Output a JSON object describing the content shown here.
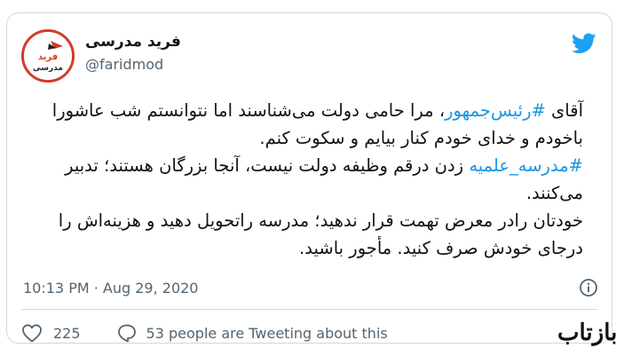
{
  "author": {
    "display_name": "فرید مدرسی",
    "handle": "@faridmod",
    "avatar_text": "فرید مدرسی"
  },
  "tweet": {
    "para1": {
      "before": "آقای ",
      "hashtag": "#رئیس‌جمهور",
      "after": "، مرا حامی دولت می‌شناسند اما نتوانستم شب عاشورا باخودم و خدای خودم کنار بیایم و سکوت کنم."
    },
    "para2": {
      "hashtag": "#مدرسه_علمیه",
      "after": " زدن درقم وظیفه دولت نیست، آنجا بزرگان هستند؛ تدبیر می‌کنند."
    },
    "para3": "خودتان رادر معرض تهمت قرار ندهید؛ مدرسه راتحویل دهید و هزینه‌اش را درجای خودش صرف کنید. مأجور باشید."
  },
  "meta": {
    "timestamp": "10:13 PM · Aug 29, 2020"
  },
  "actions": {
    "like_count": "225",
    "tweeting_text": "53 people are Tweeting about this"
  },
  "watermark": {
    "text": "بازتاب"
  },
  "colors": {
    "hashtag": "#1b95e0",
    "twitter_blue": "#1da1f2",
    "avatar_ring": "#d23b2a"
  },
  "icons": [
    "twitter-bird-icon",
    "info-icon",
    "heart-icon",
    "comment-bubble-icon"
  ]
}
